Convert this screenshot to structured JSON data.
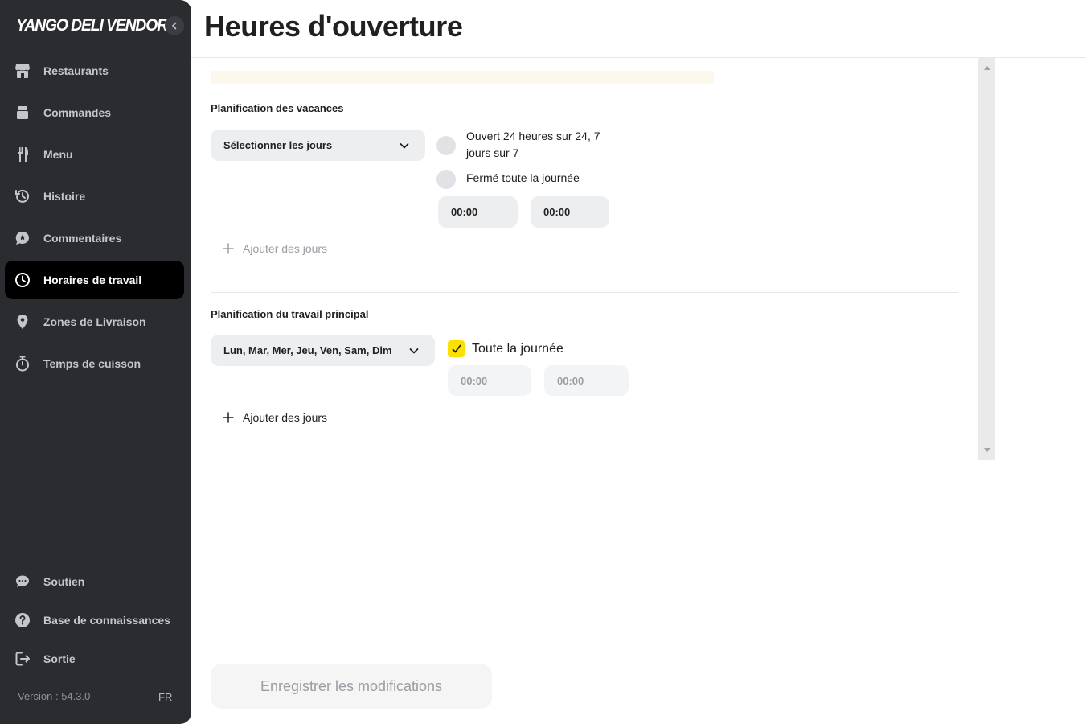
{
  "sidebar": {
    "brand": "YANGO DELI VENDOR",
    "items": [
      {
        "label": "Restaurants",
        "icon": "store-icon"
      },
      {
        "label": "Commandes",
        "icon": "orders-icon"
      },
      {
        "label": "Menu",
        "icon": "fork-knife-icon"
      },
      {
        "label": "Histoire",
        "icon": "history-icon"
      },
      {
        "label": "Commentaires",
        "icon": "feedback-icon"
      },
      {
        "label": "Horaires de travail",
        "icon": "clock-icon",
        "active": true
      },
      {
        "label": "Zones de Livraison",
        "icon": "location-pin-icon"
      },
      {
        "label": "Temps de cuisson",
        "icon": "stopwatch-icon"
      }
    ],
    "bottom_items": [
      {
        "label": "Soutien",
        "icon": "chat-icon"
      },
      {
        "label": "Base de connaissances",
        "icon": "help-icon"
      },
      {
        "label": "Sortie",
        "icon": "logout-icon"
      }
    ],
    "version": "Version : 54.3.0",
    "language": "FR"
  },
  "header": {
    "title": "Heures d'ouverture"
  },
  "holiday": {
    "title": "Planification des vacances",
    "select_label": "Sélectionner les jours",
    "radio_247": "Ouvert 24 heures sur 24, 7 jours sur 7",
    "radio_closed": "Fermé toute la journée",
    "from": "00:00",
    "to": "00:00",
    "add_days": "Ajouter des jours"
  },
  "main_schedule": {
    "title": "Planification du travail principal",
    "select_label": "Lun, Mar, Mer, Jeu, Ven, Sam, Dim",
    "all_day_label": "Toute la journée",
    "all_day_checked": true,
    "from": "00:00",
    "to": "00:00",
    "add_days": "Ajouter des jours"
  },
  "save_button": "Enregistrer les modifications",
  "colors": {
    "sidebar_bg": "#2b2c30",
    "accent": "#fce000",
    "active_item": "#000000"
  }
}
